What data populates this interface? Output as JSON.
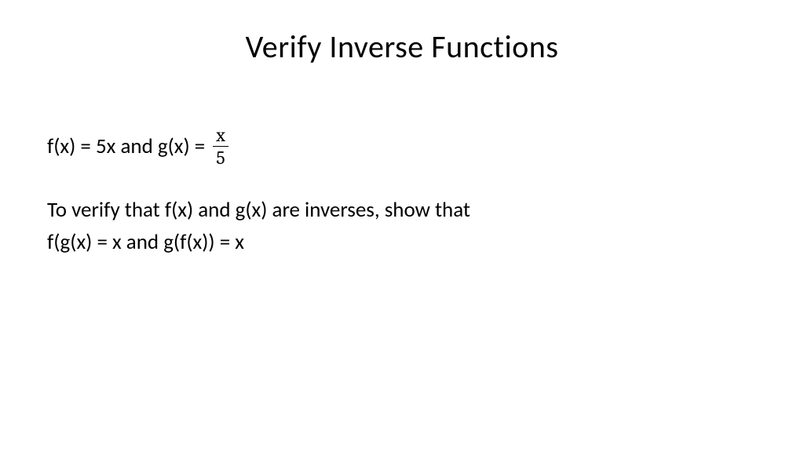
{
  "slide": {
    "title": "Verify Inverse Functions",
    "line1_prefix": "f(x) = 5x and g(x) =",
    "fraction": {
      "numerator": "x",
      "denominator": "5"
    },
    "line2": "To verify that f(x) and g(x) are inverses, show that",
    "line3": "f(g(x) = x and g(f(x)) = x"
  }
}
